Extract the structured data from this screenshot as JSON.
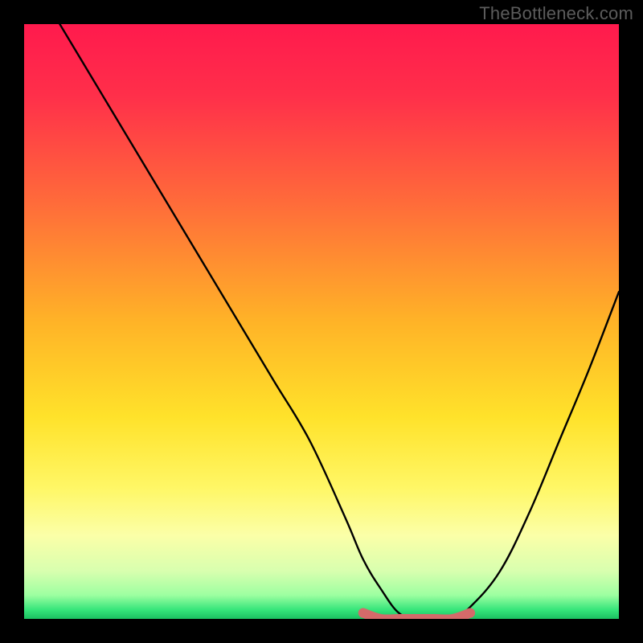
{
  "attribution": "TheBottleneck.com",
  "chart_data": {
    "type": "line",
    "title": "",
    "xlabel": "",
    "ylabel": "",
    "xlim": [
      0,
      100
    ],
    "ylim": [
      0,
      100
    ],
    "series": [
      {
        "name": "bottleneck-curve",
        "x": [
          0,
          6,
          12,
          18,
          24,
          30,
          36,
          42,
          48,
          54,
          57,
          60,
          63,
          66,
          69,
          72,
          75,
          80,
          85,
          90,
          95,
          100
        ],
        "values": [
          110,
          100,
          90,
          80,
          70,
          60,
          50,
          40,
          30,
          17,
          10,
          5,
          1,
          0,
          0,
          0,
          2,
          8,
          18,
          30,
          42,
          55
        ]
      },
      {
        "name": "sweet-spot-band",
        "x": [
          57,
          60,
          63,
          66,
          69,
          72,
          75
        ],
        "values": [
          1,
          0,
          0,
          0,
          0,
          0,
          1
        ]
      }
    ],
    "gradient_stops": [
      {
        "pos": 0.0,
        "color": "#ff1a4d"
      },
      {
        "pos": 0.12,
        "color": "#ff2f4a"
      },
      {
        "pos": 0.3,
        "color": "#ff6b3a"
      },
      {
        "pos": 0.5,
        "color": "#ffb327"
      },
      {
        "pos": 0.66,
        "color": "#ffe22a"
      },
      {
        "pos": 0.78,
        "color": "#fff766"
      },
      {
        "pos": 0.86,
        "color": "#fbffa8"
      },
      {
        "pos": 0.92,
        "color": "#d8ffaf"
      },
      {
        "pos": 0.96,
        "color": "#9dffa1"
      },
      {
        "pos": 0.985,
        "color": "#35e57a"
      },
      {
        "pos": 1.0,
        "color": "#1bc061"
      }
    ],
    "sweet_spot_color": "#d46a6a"
  }
}
